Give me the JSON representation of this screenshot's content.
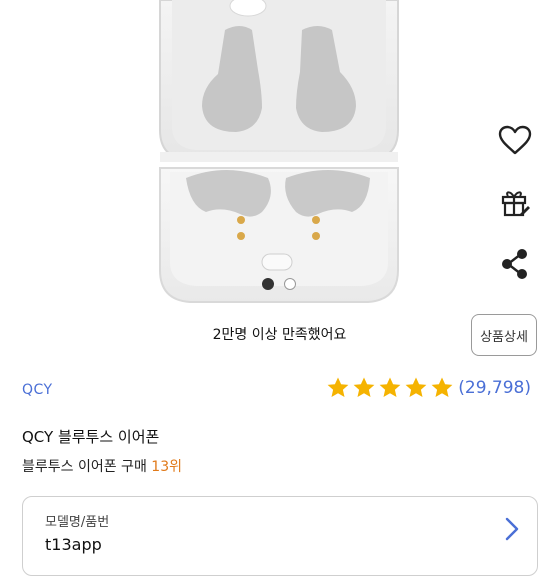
{
  "carousel": {
    "caption": "2만명 이상 만족했어요",
    "active_index": 0,
    "dot_count": 2
  },
  "actions": {
    "like_icon": "heart-icon",
    "gift_icon": "gift-icon",
    "share_icon": "share-icon"
  },
  "detail_button_label": "상품상세",
  "product": {
    "brand": "QCY",
    "rating_stars": 5,
    "rating_count": "(29,798)",
    "title": "QCY 블루투스 이어폰",
    "rank_prefix": "블루투스 이어폰 구매 ",
    "rank_value": "13위"
  },
  "model": {
    "label": "모델명/품번",
    "value": "t13app"
  },
  "colors": {
    "accent_blue": "#4a6fd6",
    "star_gold": "#f5b301",
    "rank_orange": "#e07a1a"
  }
}
